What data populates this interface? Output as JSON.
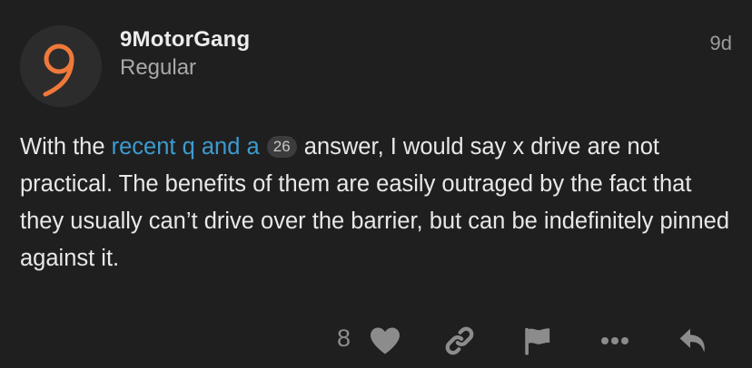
{
  "post": {
    "author": {
      "username": "9MotorGang",
      "title": "Regular",
      "avatar_letter": "9",
      "avatar_color": "#f0793a"
    },
    "date": "9d",
    "body": {
      "before_link": "With the ",
      "link_text": "recent q and a",
      "click_count": "26",
      "after_link": " answer, I would say x drive are not practical. The benefits of them are easily outraged by the fact that they usually can’t drive over the barrier, but can be indefinitely pinned against it."
    },
    "actions": {
      "like_count": "8",
      "icons": [
        "heart-icon",
        "link-icon",
        "flag-icon",
        "more-icon",
        "reply-icon"
      ]
    }
  },
  "colors": {
    "background": "#1f1f1f",
    "link": "#3d9bd0",
    "text": "#e8e8e8",
    "muted": "#9c9c9c"
  }
}
